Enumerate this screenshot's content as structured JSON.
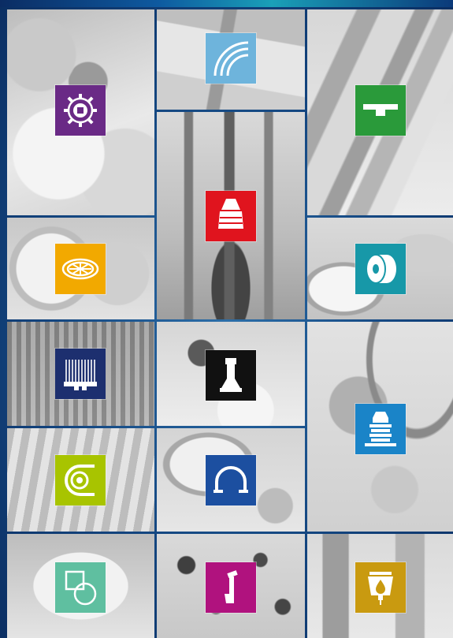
{
  "page": {
    "background": "#123a6e",
    "accent_bar": "#1aa0b8"
  },
  "tiles": [
    {
      "id": "gears",
      "icon": "gear-icon",
      "color": "#6a2a86"
    },
    {
      "id": "curve",
      "icon": "curved-track-icon",
      "color": "#6eb4dc"
    },
    {
      "id": "profile",
      "icon": "t-profile-icon",
      "color": "#2a9a3a"
    },
    {
      "id": "pulley",
      "icon": "pulley-wheel-icon",
      "color": "#f2a900"
    },
    {
      "id": "nozzle",
      "icon": "nozzle-icon",
      "color": "#e0141e"
    },
    {
      "id": "roller",
      "icon": "roller-icon",
      "color": "#1798a8"
    },
    {
      "id": "brush",
      "icon": "brush-strip-icon",
      "color": "#1d2f6f"
    },
    {
      "id": "fitting",
      "icon": "fitting-icon",
      "color": "#111111"
    },
    {
      "id": "bellows",
      "icon": "bellows-icon",
      "color": "#1a84c8"
    },
    {
      "id": "chain",
      "icon": "chain-sprocket-icon",
      "color": "#a8c400"
    },
    {
      "id": "arch",
      "icon": "arch-clip-icon",
      "color": "#1c4fa0"
    },
    {
      "id": "shapes",
      "icon": "square-circle-icon",
      "color": "#5fbfa0"
    },
    {
      "id": "hook",
      "icon": "hook-icon",
      "color": "#b0127e"
    },
    {
      "id": "drip",
      "icon": "oil-drop-icon",
      "color": "#c99a10"
    }
  ]
}
